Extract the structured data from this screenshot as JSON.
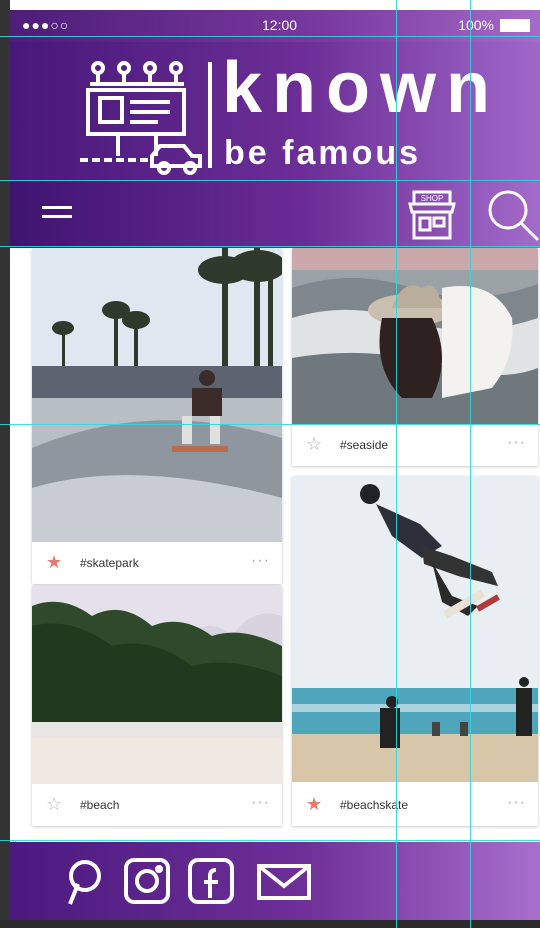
{
  "status": {
    "signal": "●●●○○",
    "time": "12:00",
    "battery": "100%"
  },
  "brand": {
    "title": "known",
    "subtitle": "be famous"
  },
  "toolbar": {
    "shop_label": "SHOP"
  },
  "feed": {
    "left": [
      {
        "tag": "#skatepark",
        "starred": true
      },
      {
        "tag": "#beach",
        "starred": false
      }
    ],
    "right": [
      {
        "tag": "#seaside",
        "starred": false
      },
      {
        "tag": "#beachskate",
        "starred": true
      }
    ],
    "more": "···"
  },
  "social": [
    "pinterest-icon",
    "instagram-icon",
    "facebook-icon",
    "mail-icon"
  ],
  "colors": {
    "purple_dark": "#47187a",
    "purple_light": "#a067c9",
    "guide": "#30d6e0",
    "star_active": "#e57b6e"
  }
}
